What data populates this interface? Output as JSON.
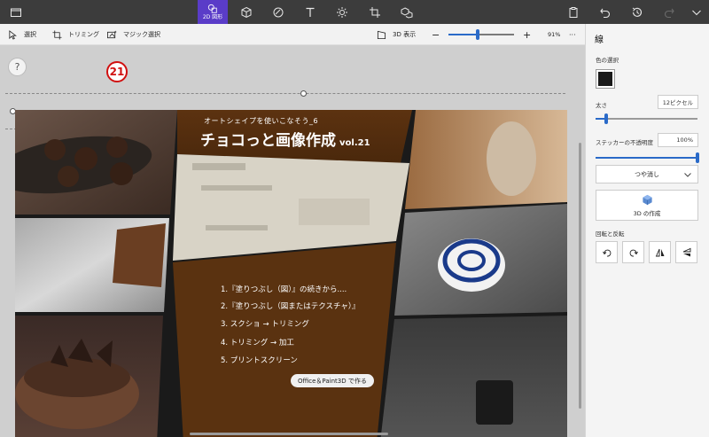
{
  "ribbon": {
    "tabs": [
      {
        "name": "menu",
        "icon": "folder-icon"
      },
      {
        "name": "brushes",
        "icon": "brush-icon"
      },
      {
        "name": "2d-shapes",
        "icon": "2d-shapes-icon",
        "label": "2D 図形",
        "active": true
      },
      {
        "name": "3d-shapes",
        "icon": "cube-icon"
      },
      {
        "name": "stickers",
        "icon": "sticker-icon"
      },
      {
        "name": "text",
        "icon": "text-icon"
      },
      {
        "name": "effects",
        "icon": "sun-icon"
      },
      {
        "name": "canvas",
        "icon": "crop-icon"
      },
      {
        "name": "3d-library",
        "icon": "3d-library-icon"
      }
    ],
    "right_icons": [
      "paste-icon",
      "undo-icon",
      "history-icon",
      "redo-icon",
      "chevron-down-icon"
    ],
    "accent": "#5a3cc8"
  },
  "commandbar": {
    "select_label": "選択",
    "crop_label": "トリミング",
    "magic_select_label": "マジック選択",
    "view3d_label": "3D 表示",
    "zoom_minus": "−",
    "zoom_plus": "+",
    "zoom_fraction": 0.45,
    "zoom_value": "91%",
    "more": "···"
  },
  "canvas": {
    "help": "?",
    "page_number": "21",
    "artwork": {
      "subtitle": "オートシェイプを使いこなそう_6",
      "title": "チョコっと画像作成",
      "volume": "vol.21",
      "list": [
        "1.『塗りつぶし（図）』の続きから....",
        "2.『塗りつぶし（図またはテクスチャ）』",
        "3. スクショ → トリミング",
        "4. トリミング → 加工",
        "5. プリントスクリーン"
      ],
      "tag": "Office＆Paint3D で作る",
      "panel_color": "#5a3010"
    }
  },
  "panel": {
    "title": "線",
    "color_label": "色の選択",
    "color_value": "#1a1a1a",
    "thickness_label": "太さ",
    "thickness_value": "12ピクセル",
    "thickness_fraction": 0.1,
    "opacity_label": "ステッカーの不透明度",
    "opacity_value": "100%",
    "opacity_fraction": 1.0,
    "finish_value": "つや消し",
    "make3d_label": "3D の作成",
    "rotate_label": "回転と反転",
    "rotate_buttons": [
      "rotate-left-icon",
      "rotate-right-icon",
      "flip-horizontal-icon",
      "flip-vertical-icon"
    ]
  }
}
